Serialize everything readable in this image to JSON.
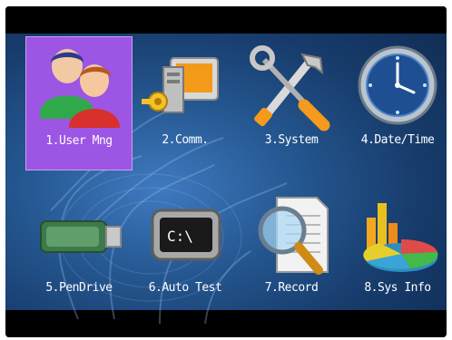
{
  "menu": {
    "items": [
      {
        "label": "1.User Mng",
        "icon": "users-icon",
        "selected": true
      },
      {
        "label": "2.Comm.",
        "icon": "communication-icon",
        "selected": false
      },
      {
        "label": "3.System",
        "icon": "tools-icon",
        "selected": false
      },
      {
        "label": "4.Date/Time",
        "icon": "clock-icon",
        "selected": false
      },
      {
        "label": "5.PenDrive",
        "icon": "usb-drive-icon",
        "selected": false
      },
      {
        "label": "6.Auto Test",
        "icon": "terminal-icon",
        "selected": false
      },
      {
        "label": "7.Record",
        "icon": "search-document-icon",
        "selected": false
      },
      {
        "label": "8.Sys Info",
        "icon": "charts-icon",
        "selected": false
      }
    ]
  },
  "colors": {
    "selection": "#9d55e4",
    "background": "#1e4a80",
    "text": "#ffffff"
  }
}
